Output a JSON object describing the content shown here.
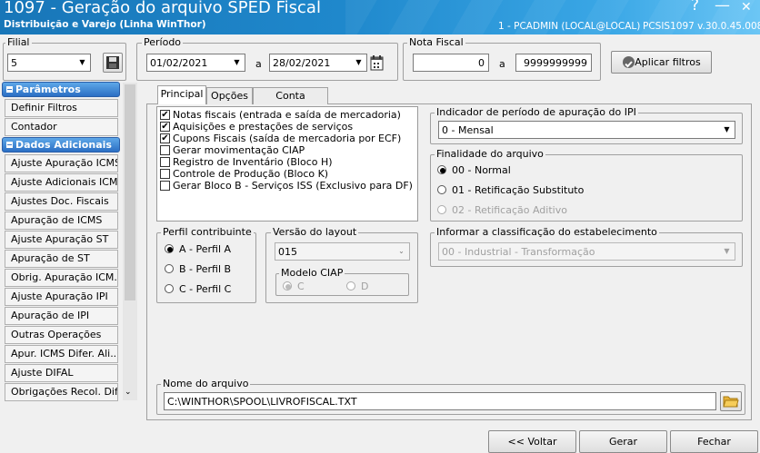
{
  "window": {
    "title": "1097 - Geração do arquivo SPED Fiscal",
    "subtitle": "Distribuição e Varejo (Linha WinThor)",
    "user": "1 - PCADMIN (LOCAL@LOCAL)",
    "version": "PCSIS1097  v.30.0.45.008",
    "help_glyph": "?",
    "minimize_glyph": "—",
    "close_glyph": "✕"
  },
  "filial": {
    "label": "Filial",
    "value": "5"
  },
  "periodo": {
    "label": "Período",
    "start": "01/02/2021",
    "separator": "a",
    "end": "28/02/2021"
  },
  "nota_fiscal": {
    "label": "Nota Fiscal",
    "start": "0",
    "separator": "a",
    "end": "9999999999"
  },
  "apply_filters": "Aplicar filtros",
  "sidebar": {
    "parametros_header": "Parâmetros",
    "parametros_items": [
      "Definir Filtros",
      "Contador"
    ],
    "dados_header": "Dados Adicionais",
    "dados_items": [
      "Ajuste Apuração ICMS",
      "Ajuste Adicionais ICMS",
      "Ajustes Doc. Fiscais",
      "Apuração de ICMS",
      "Ajuste Apuração ST",
      "Apuração de ST",
      "Obrig. Apuração ICM...",
      "Ajuste Apuração IPI",
      "Apuração de IPI",
      "Outras Operações",
      "Apur. ICMS Difer. Ali...",
      "Ajuste DIFAL",
      "Obrigações Recol. Difal"
    ]
  },
  "tabs": [
    "Principal",
    "Opções",
    "Conta Contábil"
  ],
  "checklist": [
    {
      "label": "Notas fiscais (entrada e saída de mercadoria)",
      "checked": true
    },
    {
      "label": "Aquisições e prestações de serviços",
      "checked": true
    },
    {
      "label": "Cupons Fiscais (saída de mercadoria por ECF)",
      "checked": true
    },
    {
      "label": "Gerar movimentação CIAP",
      "checked": false
    },
    {
      "label": "Registro de Inventário (Bloco H)",
      "checked": false
    },
    {
      "label": "Controle de Produção (Bloco K)",
      "checked": false
    },
    {
      "label": "Gerar Bloco B - Serviços ISS (Exclusivo para DF)",
      "checked": false
    }
  ],
  "ipi_indicator": {
    "label": "Indicador de período de apuração do IPI",
    "value": "0 - Mensal"
  },
  "finalidade": {
    "label": "Finalidade do arquivo",
    "options": [
      "00 - Normal",
      "01 - Retificação Substituto",
      "02 - Retificação Aditivo"
    ],
    "selected": 0
  },
  "perfil": {
    "label": "Perfil contribuinte",
    "options": [
      "A - Perfil A",
      "B - Perfil B",
      "C - Perfil C"
    ],
    "selected": 0
  },
  "versao": {
    "label": "Versão do layout",
    "value": "015"
  },
  "ciap": {
    "label": "Modelo CIAP",
    "options": [
      "C",
      "D"
    ],
    "selected": 0
  },
  "classificacao": {
    "label": "Informar a classificação do estabelecimento",
    "value": "00 - Industrial - Transformação"
  },
  "arquivo": {
    "label": "Nome do arquivo",
    "value": "C:\\WINTHOR\\SPOOL\\LIVROFISCAL.TXT"
  },
  "footer": {
    "back": "<< Voltar",
    "generate": "Gerar",
    "close": "Fechar"
  },
  "colors": {
    "title_bar": "#1f88cc",
    "section_header": "#2b6fc4"
  },
  "icons": {
    "save": "floppy-disk-icon",
    "calendar": "calendar-icon",
    "filter": "filter-icon",
    "folder": "folder-icon"
  }
}
